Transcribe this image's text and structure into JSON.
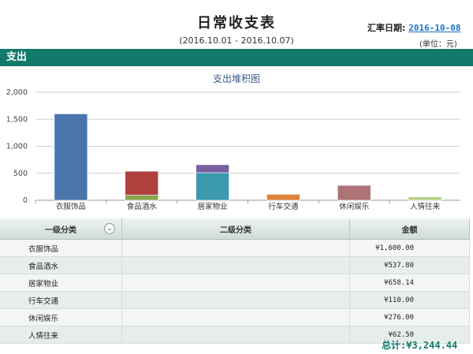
{
  "header": {
    "title": "日常收支表",
    "period": "(2016.10.01 - 2016.10.07)",
    "rate_label": "汇率日期:",
    "rate_date": "2016-10-08",
    "unit": "(单位：元)"
  },
  "section": {
    "title": "支出"
  },
  "chart_data": {
    "type": "bar",
    "title": "支出堆积图",
    "categories": [
      "衣服饰品",
      "食品酒水",
      "居家物业",
      "行车交通",
      "休闲娱乐",
      "人情往来"
    ],
    "series": [
      {
        "values": [
          1600,
          95,
          510,
          110,
          276,
          62.5
        ],
        "colors": [
          "#4a74ac",
          "#84a84a",
          "#3b9ab0",
          "#e0843a",
          "#ad7377",
          "#b8d28c"
        ]
      },
      {
        "values": [
          0,
          442.8,
          148.14,
          0,
          0,
          0
        ],
        "colors": [
          "#4a74ac",
          "#b0403e",
          "#7b5ea2",
          "#e0843a",
          "#ad7377",
          "#b8d28c"
        ]
      }
    ],
    "ylim": [
      0,
      2000
    ],
    "yticks": [
      "2,000",
      "1,500",
      "1,000",
      "500",
      "0"
    ],
    "grid": true
  },
  "table": {
    "headers": [
      "一级分类",
      "二级分类",
      "金额"
    ],
    "rows": [
      {
        "cat": "衣服饰品",
        "sub": "",
        "amount": "¥1,600.00"
      },
      {
        "cat": "食品酒水",
        "sub": "",
        "amount": "¥537.80"
      },
      {
        "cat": "居家物业",
        "sub": "",
        "amount": "¥658.14"
      },
      {
        "cat": "行车交通",
        "sub": "",
        "amount": "¥110.00"
      },
      {
        "cat": "休闲娱乐",
        "sub": "",
        "amount": "¥276.00"
      },
      {
        "cat": "人情往来",
        "sub": "",
        "amount": "¥62.50"
      }
    ]
  },
  "footer": {
    "total": "总计:¥3,244.44"
  }
}
